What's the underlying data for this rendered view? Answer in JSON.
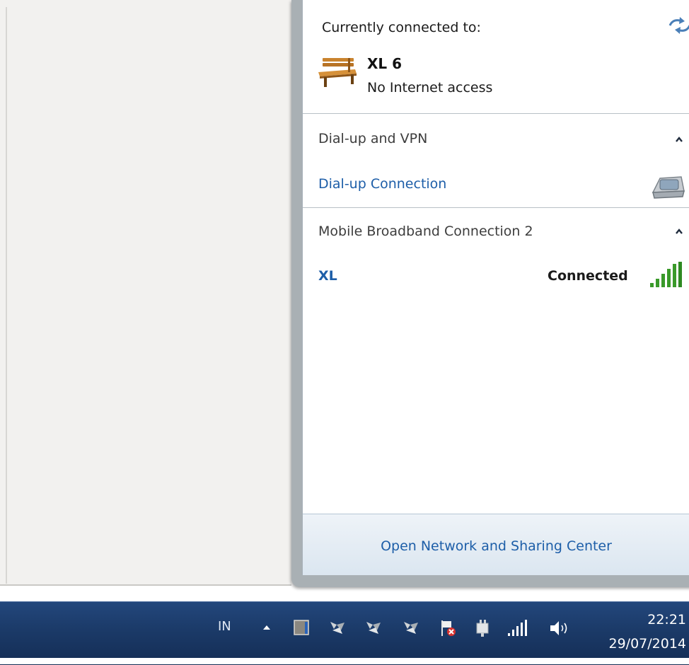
{
  "popup": {
    "current_label": "Currently connected to:",
    "current_network": {
      "name": "XL 6",
      "status": "No Internet access",
      "icon": "bench-icon"
    },
    "groups": [
      {
        "title": "Dial-up and VPN",
        "items": [
          {
            "label": "Dial-up Connection",
            "icon": "phone-modem-icon"
          }
        ]
      },
      {
        "title": "Mobile Broadband Connection 2",
        "items": [
          {
            "label": "XL",
            "status": "Connected",
            "icon": "signal-strength-icon"
          }
        ]
      }
    ],
    "footer_link": "Open Network and Sharing Center"
  },
  "taskbar": {
    "language": "IN",
    "tray_icons": [
      "show-hidden-icons-icon",
      "app-icon",
      "network-activity-icon",
      "network-activity-icon",
      "network-activity-icon",
      "action-center-icon",
      "power-icon",
      "signal-strength-icon",
      "volume-icon"
    ],
    "time": "22:21",
    "date": "29/07/2014"
  },
  "colors": {
    "link": "#1d5ea8",
    "taskbar": "#1b3a68",
    "signal": "#3a9a2a"
  }
}
